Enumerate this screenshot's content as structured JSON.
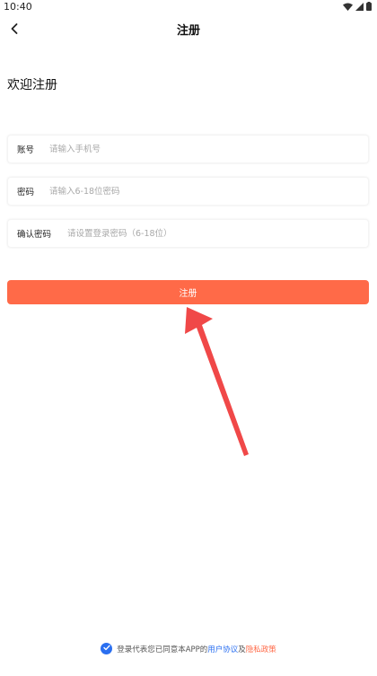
{
  "status_bar": {
    "time": "10:40"
  },
  "header": {
    "title": "注册"
  },
  "welcome": "欢迎注册",
  "fields": {
    "account": {
      "label": "账号",
      "placeholder": "请输入手机号",
      "value": ""
    },
    "password": {
      "label": "密码",
      "placeholder": "请输入6-18位密码",
      "value": ""
    },
    "confirm": {
      "label": "确认密码",
      "placeholder": "请设置登录密码（6-18位）",
      "value": ""
    }
  },
  "submit_label": "注册",
  "agreement": {
    "checked": true,
    "prefix": "登录代表您已同意本APP的",
    "user_agreement": "用户协议",
    "and": "及",
    "privacy_policy": "隐私政策"
  },
  "colors": {
    "accent": "#ff6a48",
    "link_blue": "#2a6ff0",
    "arrow": "#f04848"
  },
  "icons": [
    "wifi-icon",
    "signal-icon",
    "battery-icon",
    "back-arrow-icon",
    "checkmark-icon",
    "annotation-arrow-icon"
  ]
}
